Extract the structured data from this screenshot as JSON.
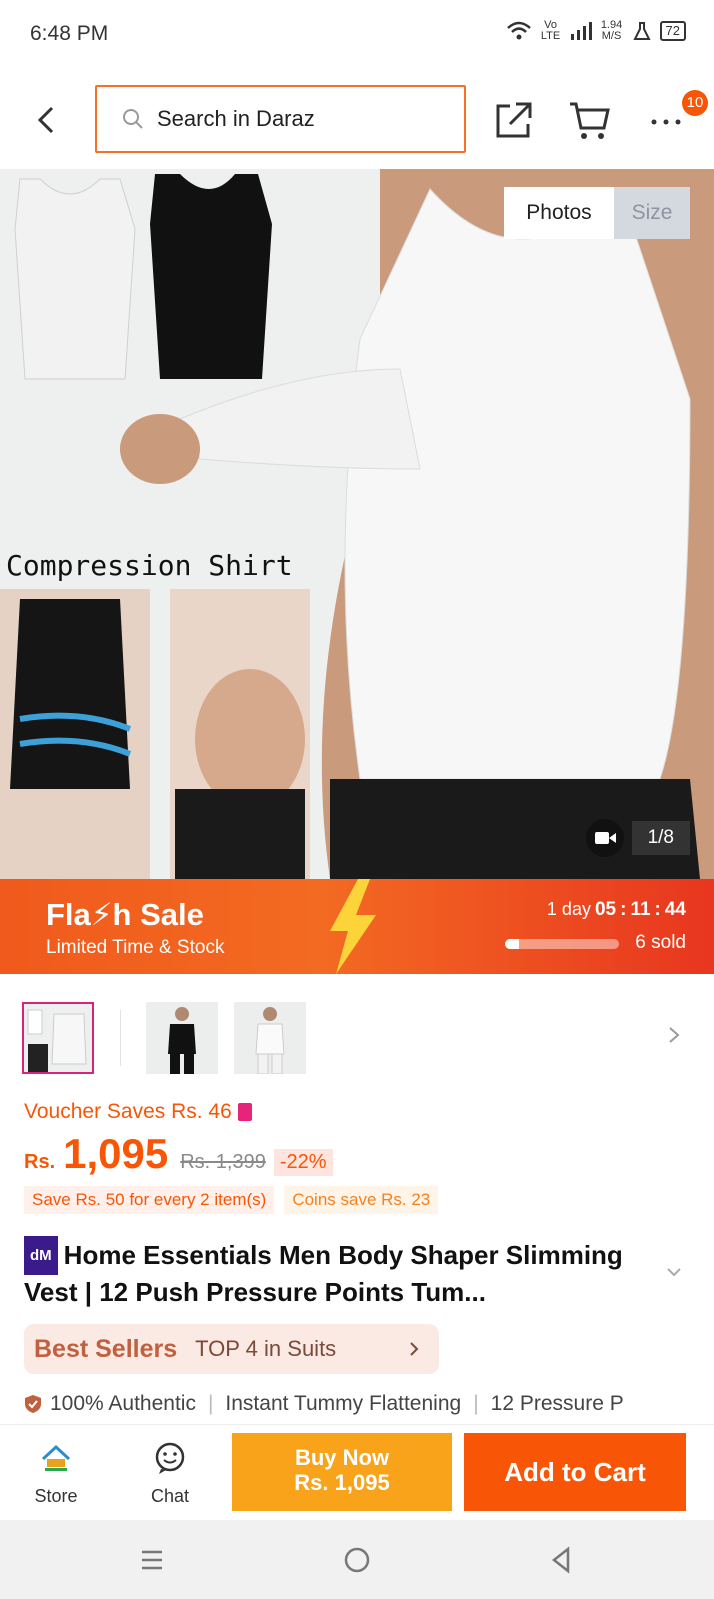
{
  "status_bar": {
    "time": "6:48 PM",
    "lte": "Vo LTE",
    "speed": "1.94 M/S",
    "battery": "72"
  },
  "header": {
    "search_placeholder": "Search in Daraz",
    "cart_badge": "10"
  },
  "gallery": {
    "tabs": [
      "Photos",
      "Size"
    ],
    "counter": "1/8",
    "caption": "Compression Shirt"
  },
  "flash_sale": {
    "title": "Fla⚡h Sale",
    "subtitle": "Limited Time & Stock",
    "timer_days": "1 day",
    "timer_h": "05",
    "timer_m": "11",
    "timer_s": "44",
    "sold": "6 sold",
    "sold_progress": 0.12
  },
  "pricing": {
    "voucher": "Voucher Saves Rs. 46",
    "currency": "Rs.",
    "price": "1,095",
    "old_price": "Rs. 1,399",
    "discount": "-22%",
    "promo_bulk": "Save Rs. 50 for every 2 item(s)",
    "promo_coins": "Coins save Rs. 23"
  },
  "product": {
    "brand_tag": "dM",
    "title": "Home Essentials Men Body Shaper Slimming Vest | 12 Push Pressure Points Tum..."
  },
  "best_sellers": {
    "label": "Best Sellers",
    "rank": "TOP 4 in Suits"
  },
  "features": [
    "100% Authentic",
    "Instant Tummy Flattening",
    "12 Pressure P"
  ],
  "bottom_bar": {
    "store": "Store",
    "chat": "Chat",
    "buy_now": "Buy Now",
    "buy_now_price": "Rs. 1,095",
    "add_to_cart": "Add to Cart"
  },
  "colors": {
    "accent": "#f85606",
    "buy_now": "#f9a31b"
  }
}
